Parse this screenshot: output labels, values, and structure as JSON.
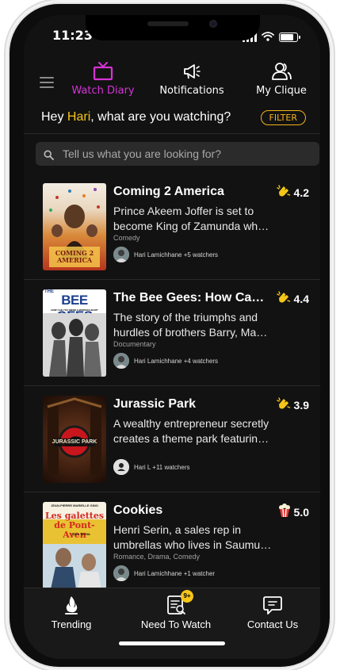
{
  "status": {
    "time": "11:23",
    "location_icon": "location-arrow-icon"
  },
  "top_nav": {
    "menu_icon": "hamburger-icon",
    "tabs": [
      {
        "label": "Watch Diary",
        "icon": "tv-icon",
        "active": true
      },
      {
        "label": "Notifications",
        "icon": "megaphone-icon",
        "active": false
      },
      {
        "label": "My Clique",
        "icon": "group-icon",
        "active": false
      }
    ]
  },
  "greeting": {
    "prefix": "Hey ",
    "name": "Hari",
    "suffix": ", what are you watching?"
  },
  "filter": {
    "label": "FILTER"
  },
  "search": {
    "placeholder": "Tell us what you are looking for?"
  },
  "feed": [
    {
      "title": "Coming 2 America",
      "rating": "4.2",
      "rating_icon": "clapping-hands-icon",
      "desc_line1": "Prince Akeem Joffer is set to",
      "desc_line2": "become King of Zamunda whe...",
      "genre": "Comedy",
      "watchers": "Hari Lamichhane +5 watchers",
      "poster_text": "COMING 2 AMERICA"
    },
    {
      "title": "The Bee Gees: How Can...",
      "rating": "4.4",
      "rating_icon": "clapping-hands-icon",
      "desc_line1": "The story of the triumphs and",
      "desc_line2": "hurdles of brothers Barry, Maur...",
      "genre": "Documentary",
      "watchers": "Hari Lamichhane +4 watchers",
      "poster_text": "BEE GEES",
      "poster_subtext": "HOW CAN YOU MEND A BROKEN HEART",
      "poster_tag": "THE"
    },
    {
      "title": "Jurassic Park",
      "rating": "3.9",
      "rating_icon": "clapping-hands-icon",
      "desc_line1": "A wealthy entrepreneur secretly",
      "desc_line2": "creates a theme park featuring...",
      "genre": "",
      "watchers": "Hari L +11 watchers",
      "poster_text": "JURASSIC PARK"
    },
    {
      "title": "Cookies",
      "rating": "5.0",
      "rating_icon": "popcorn-icon",
      "desc_line1": "Henri Serin, a sales rep in",
      "desc_line2": "umbrellas who lives in Saumur,...",
      "genre": "Romance, Drama, Comedy",
      "watchers": "Hari Lamichhane +1 watcher",
      "poster_text": "Les galettes de Pont-Aven",
      "poster_top": "JEAN-PIERRE MARIELLE GINO",
      "poster_sub": "JOEL SERIA"
    }
  ],
  "bottom_nav": {
    "tabs": [
      {
        "label": "Trending",
        "icon": "flame-icon"
      },
      {
        "label": "Need To Watch",
        "icon": "watchlist-icon",
        "badge": "9+"
      },
      {
        "label": "Contact Us",
        "icon": "chat-icon"
      }
    ]
  },
  "colors": {
    "accent": "#d633d6",
    "highlight": "#f5c518",
    "filter": "#f5b21a",
    "background": "#121212"
  }
}
